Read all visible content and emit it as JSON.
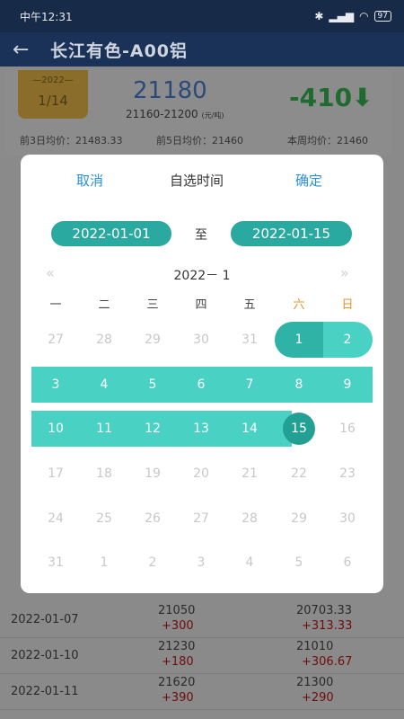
{
  "status": {
    "time": "中午12:31",
    "battery": "97"
  },
  "appbar": {
    "title": "长江有色-A00铝"
  },
  "summary": {
    "date_year": "—2022—",
    "date_day": "1/14",
    "price": "21180",
    "range": "21160-21200",
    "unit": "(元/吨)",
    "change": "-410",
    "avg3": "前3日均价：21483.33",
    "avg5": "前5日均价：21460",
    "avg_week": "本周均价：21460"
  },
  "rows": [
    {
      "date": "2022-01-07",
      "v1": "21050",
      "d1": "+300",
      "v2": "20703.33",
      "d2": "+313.33"
    },
    {
      "date": "2022-01-10",
      "v1": "21230",
      "d1": "+180",
      "v2": "21010",
      "d2": "+306.67"
    },
    {
      "date": "2022-01-11",
      "v1": "21620",
      "d1": "+390",
      "v2": "21300",
      "d2": "+290"
    }
  ],
  "dialog": {
    "cancel": "取消",
    "title": "自选时间",
    "confirm": "确定",
    "start_date": "2022-01-01",
    "separator": "至",
    "end_date": "2022-01-15",
    "month_label": "2022－ 1",
    "prev_icon": "«",
    "next_icon": "»",
    "weekdays": [
      "一",
      "二",
      "三",
      "四",
      "五",
      "六",
      "日"
    ],
    "weeks": [
      [
        "27",
        "28",
        "29",
        "30",
        "31",
        "1",
        "2"
      ],
      [
        "3",
        "4",
        "5",
        "6",
        "7",
        "8",
        "9"
      ],
      [
        "10",
        "11",
        "12",
        "13",
        "14",
        "15",
        "16"
      ],
      [
        "17",
        "18",
        "19",
        "20",
        "21",
        "22",
        "23"
      ],
      [
        "24",
        "25",
        "26",
        "27",
        "28",
        "29",
        "30"
      ],
      [
        "31",
        "1",
        "2",
        "3",
        "4",
        "5",
        "6"
      ]
    ]
  },
  "colors": {
    "accent": "#2aa9a0",
    "range_fill": "#49d1c4",
    "link": "#2b8fd6",
    "weekend": "#e0932b"
  }
}
